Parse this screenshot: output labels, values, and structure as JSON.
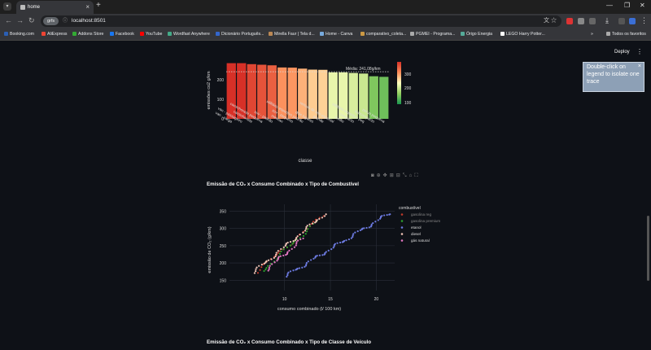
{
  "browser": {
    "tab_title": "home",
    "url": "localhost:8501",
    "profile_chip": "grfs",
    "bookmarks": [
      "Booking.com",
      "AliExpress",
      "Addons Store",
      "Facebook",
      "YouTube",
      "Wordfast Anywhere",
      "Dicionário Português...",
      "Mirella Faur | Tela d...",
      "Home - Canva",
      "comparativo_coleta...",
      "PGMEI - Programa...",
      "Órigo Energia",
      "LEGO Harry Potter..."
    ],
    "bookmarks_more": "»",
    "all_favorites": "Todos os favoritos"
  },
  "app": {
    "deploy_label": "Deploy",
    "menu_icon": "⋮",
    "tooltip_text": "Double-click on legend to isolate one trace"
  },
  "bar_chart": {
    "ylabel": "emissões co2 g/km",
    "xlabel": "classe",
    "mean_annotation": "Média: 241,08g/km",
    "colorbar_ticks": [
      "300",
      "200",
      "100"
    ]
  },
  "scatter_section": {
    "title": "Emissão de CO₂ x Consumo Combinado x Tipo de Combustível",
    "xlabel": "consumo combinado (l/ 100 km)",
    "ylabel": "emissão de CO₂ (g/km)",
    "legend_title": "combustível",
    "legend": [
      {
        "label": "gasolina reg",
        "color": "#c0392b"
      },
      {
        "label": "gasolina premium",
        "color": "#2ca02c"
      },
      {
        "label": "etanol",
        "color": "#6c7ae0"
      },
      {
        "label": "diesel",
        "color": "#f2c6b8"
      },
      {
        "label": "gás natural",
        "color": "#e377c2"
      }
    ]
  },
  "next_section": {
    "title": "Emissão de CO₂ x Consumo Combinado x Tipo de Classe de Veículo"
  },
  "chart_data": [
    {
      "type": "bar",
      "ylabel": "emissões co2 g/km",
      "xlabel": "classe",
      "categories": [
        "van - carga",
        "van - passageiro",
        "caminhonete",
        "caminhonete pequena",
        "suv - padrão",
        "minivan",
        "suv - pequeno",
        "utilitário esportivo padrão",
        "dois lugares",
        "grande",
        "veículo de uso especial",
        "médio",
        "compacto",
        "utilitário esportivo peq",
        "subcompacto",
        "perua pequena"
      ],
      "values": [
        285,
        285,
        280,
        277,
        274,
        263,
        262,
        257,
        252,
        251,
        238,
        238,
        235,
        232,
        218,
        215
      ],
      "mean": 241.08,
      "ylim": [
        0,
        300
      ],
      "colorscale": "RdYlGn reversed",
      "colorbar_range": [
        100,
        300
      ]
    },
    {
      "type": "scatter",
      "xlabel": "consumo combinado (l/ 100 km)",
      "ylabel": "emissão de CO₂ (g/km)",
      "xlim": [
        4,
        22
      ],
      "ylim": [
        120,
        370
      ],
      "x_ticks": [
        10,
        15,
        20
      ],
      "y_ticks": [
        150,
        200,
        250,
        300,
        350
      ],
      "series": [
        {
          "name": "gasolina reg",
          "trend": [
            [
              6.8,
              170
            ],
            [
              14.3,
              340
            ]
          ]
        },
        {
          "name": "gasolina premium",
          "trend": [
            [
              7.5,
              175
            ],
            [
              13.5,
              320
            ]
          ]
        },
        {
          "name": "etanol",
          "trend": [
            [
              10,
              160
            ],
            [
              21.5,
              345
            ]
          ]
        },
        {
          "name": "diesel",
          "trend": [
            [
              6.5,
              170
            ],
            [
              14.5,
              345
            ]
          ]
        },
        {
          "name": "gás natural",
          "trend": [
            [
              8,
              180
            ],
            [
              12,
              270
            ]
          ]
        }
      ]
    }
  ]
}
